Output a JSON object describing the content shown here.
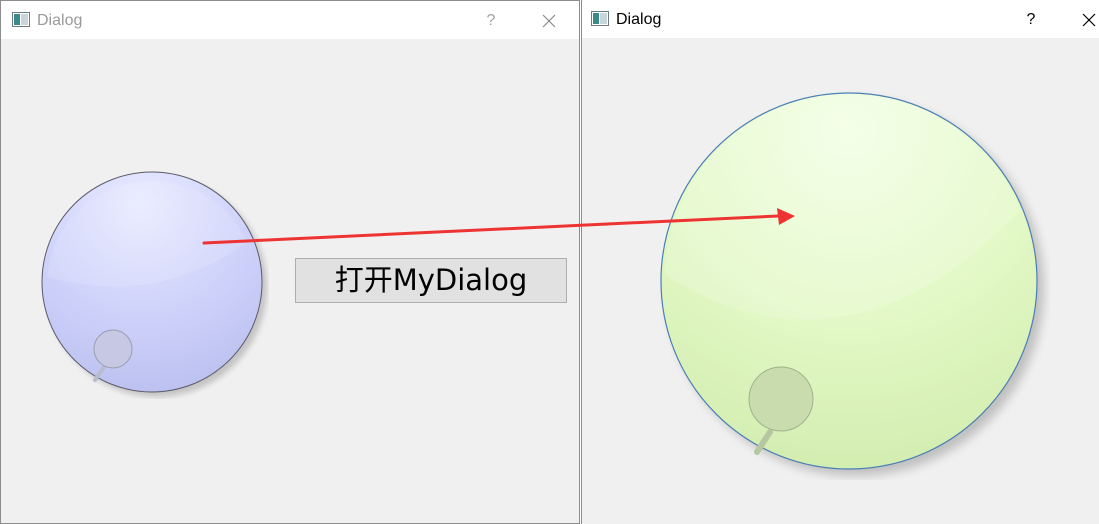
{
  "left_dialog": {
    "title": "Dialog",
    "help_label": "?",
    "open_button_label": "打开MyDialog"
  },
  "right_dialog": {
    "title": "Dialog",
    "help_label": "?"
  },
  "colors": {
    "left_dial": "#c9ccf6",
    "right_dial": "#e2f7c4",
    "annotation_arrow": "#ee3333",
    "window_bg": "#f0f0f0"
  },
  "icons": {
    "app": "window-app-icon",
    "close": "close-x-icon"
  }
}
